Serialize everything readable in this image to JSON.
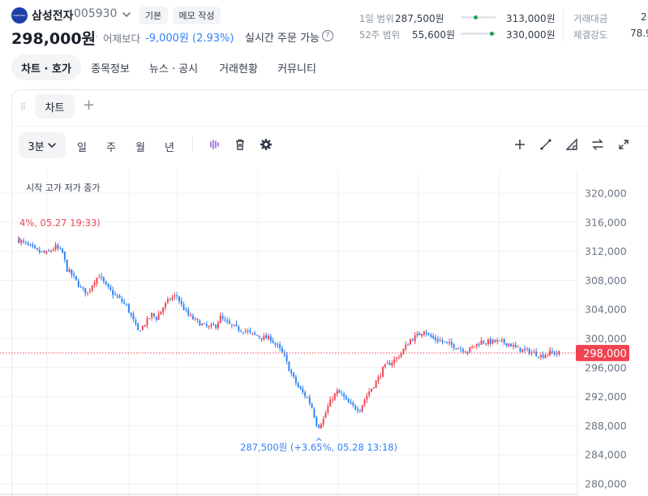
{
  "header": {
    "logo_text": "SAMSUNG",
    "stock_name": "삼성전자",
    "stock_code": "005930",
    "basic_label": "기본",
    "memo_label": "메모 작성",
    "price": "298,000원",
    "sep": "·",
    "vs_label": "어제보다",
    "change": "-9,000원 (2.93%)",
    "realtime_label": "실시간 주문 가능",
    "help_glyph": "?"
  },
  "ranges": {
    "day_label": "1일 범위",
    "day_low": "287,500원",
    "day_high": "313,000원",
    "day_position": 0.41,
    "week52_label": "52주 범위",
    "week52_low": "55,600원",
    "week52_high": "330,000원",
    "week52_position": 0.88,
    "volume_label": "거래대금",
    "volume_value": "2",
    "strength_label": "체결강도",
    "strength_value": "78.9"
  },
  "tabs": [
    {
      "label": "차트 · 호가",
      "active": true
    },
    {
      "label": "종목정보",
      "active": false
    },
    {
      "label": "뉴스 · 공시",
      "active": false
    },
    {
      "label": "거래현황",
      "active": false
    },
    {
      "label": "커뮤니티",
      "active": false
    }
  ],
  "chart_panel": {
    "tab_label": "차트",
    "add_glyph": "+",
    "timeframe_selected": "3분",
    "timeframes": [
      "일",
      "주",
      "월",
      "년"
    ],
    "ohlc_label": "시작 고가 저가 종가",
    "icons": [
      "candles-icon",
      "trash-icon",
      "gear-icon",
      "plus-icon",
      "line-tool-icon",
      "triangle-tool-icon",
      "swap-icon",
      "expand-icon"
    ]
  },
  "colors": {
    "up": "#f04452",
    "down": "#3182f6",
    "logo": "#1c3fa8",
    "range_dot": "#1aa357"
  },
  "chart_data": {
    "type": "candlestick",
    "ylim": [
      279000,
      323000
    ],
    "y_ticks": [
      "320,000",
      "316,000",
      "312,000",
      "308,000",
      "304,000",
      "300,000",
      "296,000",
      "292,000",
      "288,000",
      "284,000",
      "280,000"
    ],
    "current_price": 298000,
    "current_price_label": "298,000",
    "high_annotation": "4%, 05.27 19:33)",
    "high_value": 313000,
    "low_annotation": "287,500원 (+3.65%, 05.28 13:18)",
    "low_value": 287500,
    "close_path": [
      [
        0,
        313500
      ],
      [
        4,
        312800
      ],
      [
        8,
        312000
      ],
      [
        12,
        311700
      ],
      [
        16,
        312600
      ],
      [
        19,
        311800
      ],
      [
        21,
        309500
      ],
      [
        24,
        308400
      ],
      [
        27,
        306900
      ],
      [
        30,
        306300
      ],
      [
        33,
        308000
      ],
      [
        35,
        308700
      ],
      [
        38,
        307200
      ],
      [
        41,
        306200
      ],
      [
        44,
        305400
      ],
      [
        47,
        304500
      ],
      [
        50,
        302400
      ],
      [
        52,
        301000
      ],
      [
        55,
        302000
      ],
      [
        58,
        303300
      ],
      [
        60,
        302800
      ],
      [
        63,
        304300
      ],
      [
        66,
        305500
      ],
      [
        69,
        305900
      ],
      [
        71,
        304600
      ],
      [
        74,
        303200
      ],
      [
        77,
        302500
      ],
      [
        80,
        301900
      ],
      [
        83,
        301500
      ],
      [
        86,
        301800
      ],
      [
        88,
        302900
      ],
      [
        90,
        302300
      ],
      [
        93,
        301700
      ],
      [
        96,
        301300
      ],
      [
        99,
        301100
      ],
      [
        101,
        300700
      ],
      [
        104,
        300400
      ],
      [
        107,
        300100
      ],
      [
        110,
        300000
      ],
      [
        112,
        299200
      ],
      [
        114,
        298500
      ],
      [
        116,
        297500
      ],
      [
        118,
        295800
      ],
      [
        120,
        294500
      ],
      [
        122,
        293300
      ],
      [
        124,
        292500
      ],
      [
        126,
        291800
      ],
      [
        128,
        290500
      ],
      [
        130,
        288300
      ],
      [
        131,
        288000
      ],
      [
        133,
        288900
      ],
      [
        135,
        290600
      ],
      [
        137,
        291900
      ],
      [
        139,
        292600
      ],
      [
        141,
        292300
      ],
      [
        143,
        291400
      ],
      [
        145,
        290800
      ],
      [
        147,
        290500
      ],
      [
        149,
        290300
      ],
      [
        151,
        291600
      ],
      [
        153,
        292700
      ],
      [
        155,
        293600
      ],
      [
        157,
        294500
      ],
      [
        159,
        295800
      ],
      [
        161,
        296400
      ],
      [
        163,
        296800
      ],
      [
        165,
        297300
      ],
      [
        167,
        298000
      ],
      [
        169,
        298900
      ],
      [
        171,
        299800
      ],
      [
        173,
        300200
      ],
      [
        175,
        300600
      ],
      [
        177,
        301200
      ],
      [
        179,
        300400
      ],
      [
        181,
        300000
      ],
      [
        184,
        299700
      ],
      [
        187,
        299300
      ],
      [
        190,
        299000
      ],
      [
        193,
        298600
      ],
      [
        196,
        298300
      ],
      [
        199,
        299000
      ],
      [
        202,
        299600
      ],
      [
        205,
        299500
      ],
      [
        208,
        299600
      ],
      [
        211,
        299500
      ],
      [
        214,
        299300
      ],
      [
        217,
        298700
      ],
      [
        220,
        298400
      ],
      [
        223,
        298200
      ],
      [
        226,
        297900
      ],
      [
        228,
        297600
      ],
      [
        230,
        297800
      ],
      [
        232,
        298100
      ],
      [
        234,
        298000
      ],
      [
        236,
        298000
      ]
    ]
  }
}
